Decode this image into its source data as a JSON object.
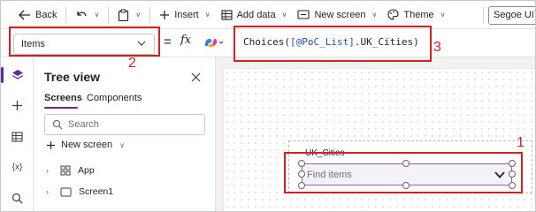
{
  "toolbar": {
    "back_label": "Back",
    "insert_label": "Insert",
    "add_data_label": "Add data",
    "new_screen_label": "New screen",
    "theme_label": "Theme",
    "font_value": "Segoe UI"
  },
  "formula_bar": {
    "property_value": "Items",
    "equals": "=",
    "fx": "fx",
    "formula_prefix": "Choices(",
    "formula_source": "[@PoC_List]",
    "formula_suffix": ".UK_Cities)"
  },
  "annotations": {
    "n1": "1",
    "n2": "2",
    "n3": "3",
    "color": "#d21f1f"
  },
  "rail": {
    "icons": [
      "layers-icon",
      "plus-icon",
      "table-icon",
      "variables-icon",
      "search-icon"
    ],
    "variables_text": "{x}"
  },
  "tree_view": {
    "title": "Tree view",
    "tabs": [
      {
        "label": "Screens"
      },
      {
        "label": "Components"
      }
    ],
    "search_placeholder": "Search",
    "new_screen_label": "New screen",
    "items": [
      {
        "label": "App",
        "icon": "app-icon"
      },
      {
        "label": "Screen1",
        "icon": "screen-icon"
      }
    ]
  },
  "canvas": {
    "control_label": "UK_Cities",
    "combo_placeholder": "Find items"
  },
  "colors": {
    "accent": "#5b2d8f",
    "annotation_red": "#d21f1f"
  }
}
